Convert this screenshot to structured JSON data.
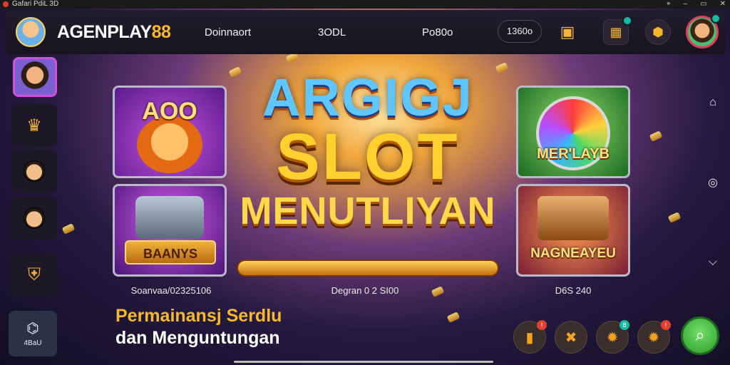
{
  "window": {
    "title": "Gafari PdiL 3D"
  },
  "header": {
    "brand_main": "AGENPLAY",
    "brand_accent": "88",
    "nav": [
      "Doinnaort",
      "3ODL",
      "Po80o"
    ],
    "balance_pill": "1360o"
  },
  "sidebar": {
    "bottom_label": "4BaU"
  },
  "center": {
    "title_line1": "ARGIGJ",
    "title_line2": "SLOT",
    "title_line3": "MENUTLIYAN",
    "caption": "Degran 0 2 SI00"
  },
  "tiles": [
    {
      "caption": "AOO",
      "label": "Soanvaa/02325106"
    },
    {
      "caption": "BAANYS",
      "label": ""
    },
    {
      "caption": "MER'LAYB",
      "label": ""
    },
    {
      "caption": "NAGNEAYEU",
      "label": "D6S 240"
    }
  ],
  "promo": {
    "line1": "Permainansj Serdlu",
    "line2": "dan Menguntungan"
  },
  "actions": {
    "badge1": "!",
    "badge2": "8",
    "badge3": "!"
  },
  "colors": {
    "accent": "#f7b928",
    "brand_bg": "#17131f",
    "search_green": "#3cba3a"
  }
}
